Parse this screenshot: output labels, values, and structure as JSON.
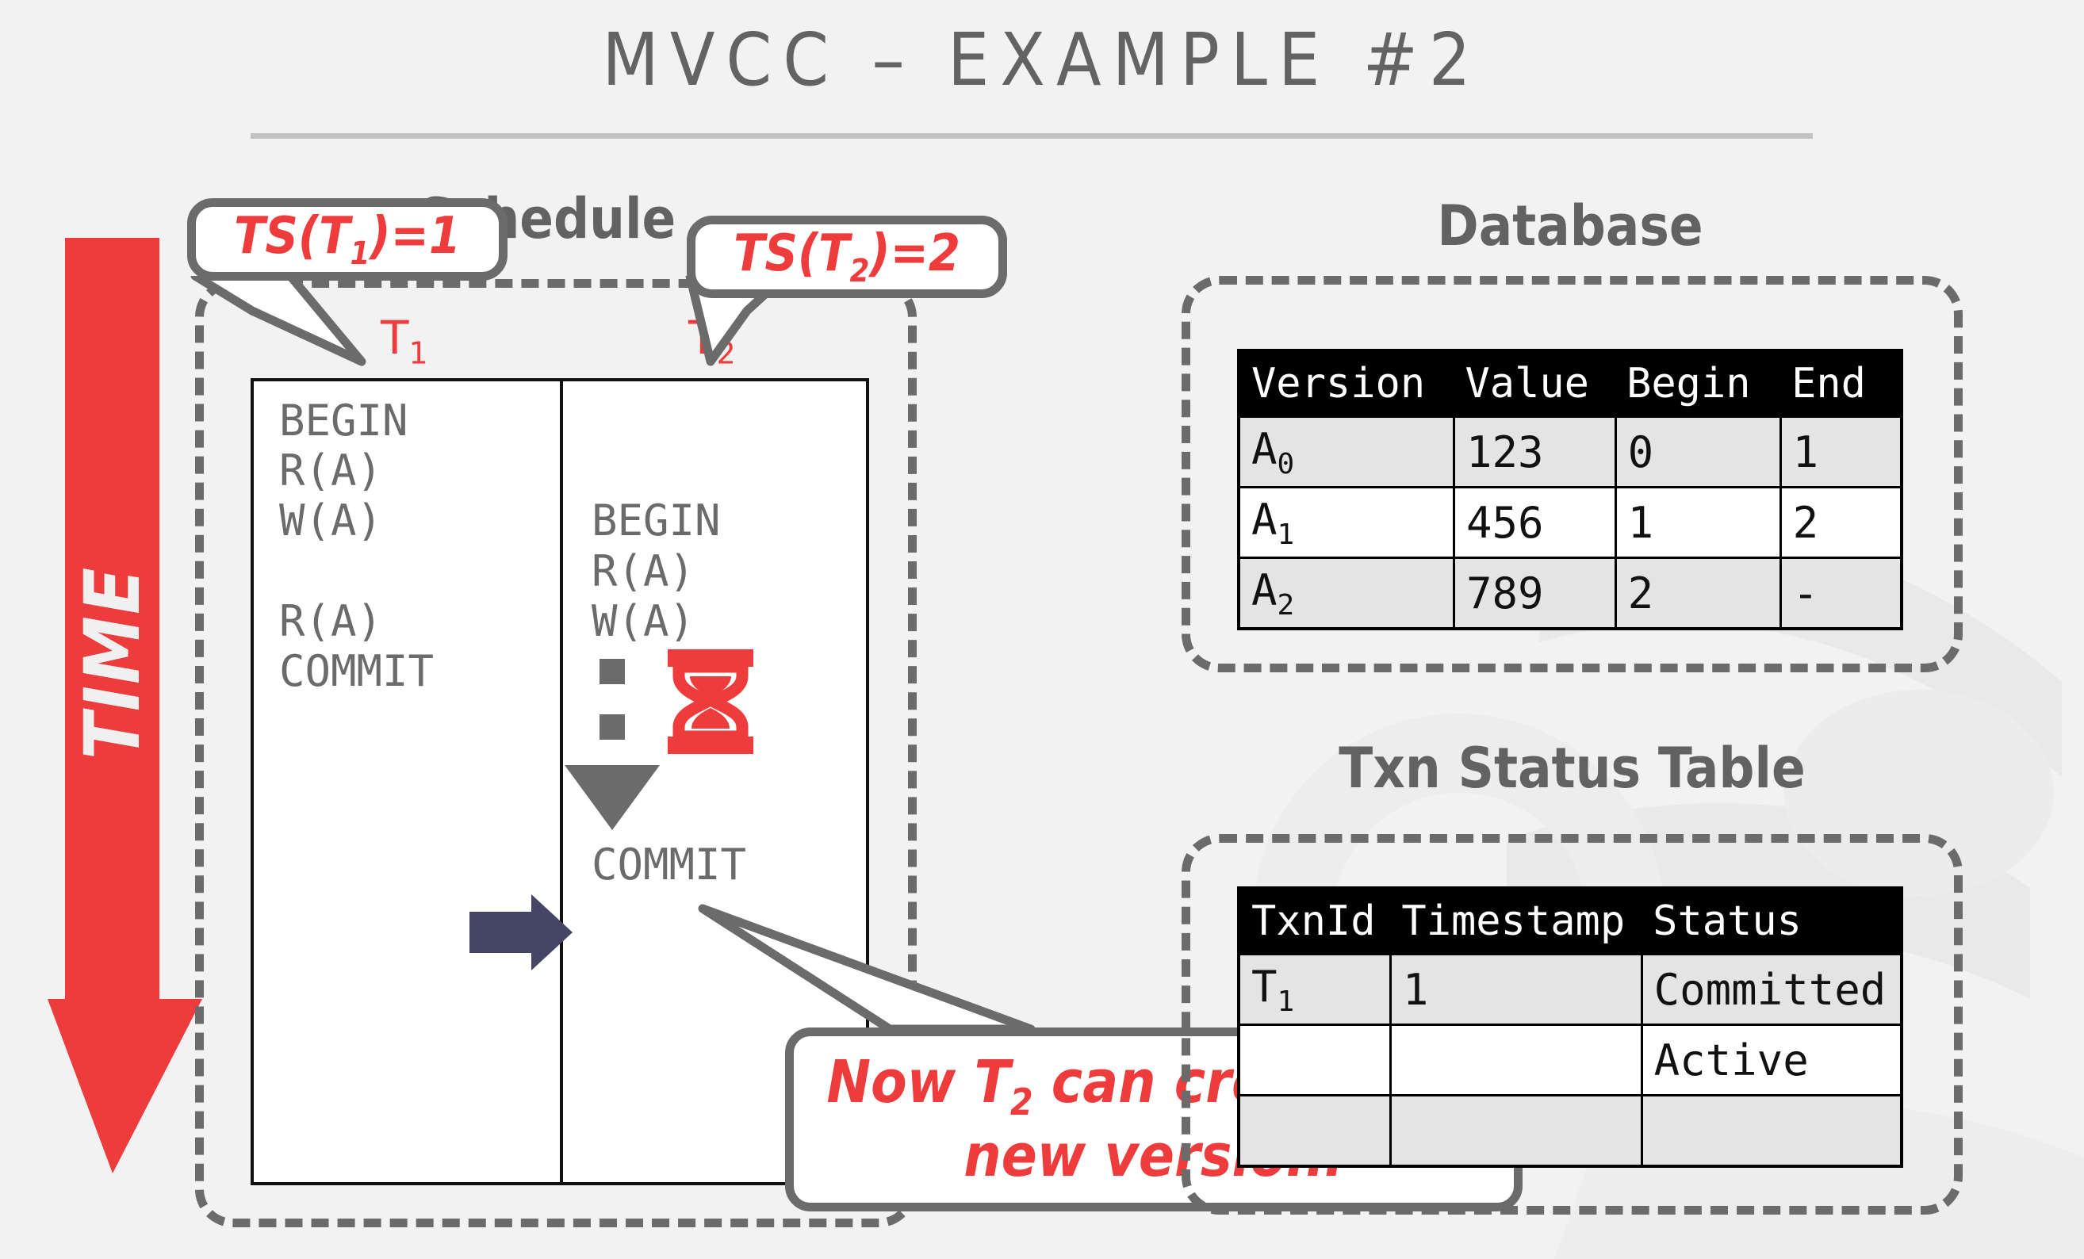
{
  "slide": {
    "title": "MVCC – EXAMPLE #2"
  },
  "time_axis": {
    "label": "TIME",
    "color": "#ee3b3b",
    "icon": "down-arrow-icon"
  },
  "schedule": {
    "heading": "Schedule",
    "columns": [
      {
        "header": "T",
        "header_sub": "1"
      },
      {
        "header": "T",
        "header_sub": "2"
      }
    ],
    "t1_ops": [
      "BEGIN",
      "R(A)",
      "W(A)",
      "",
      "R(A)",
      "COMMIT"
    ],
    "t2_ops": [
      "BEGIN",
      "R(A)",
      "W(A)"
    ],
    "t2_wait_icon": "hourglass-icon",
    "t2_wait_arrow_icon": "dashed-down-arrow-icon",
    "t2_commit": "COMMIT",
    "pointer_icon": "right-arrow-icon",
    "pointer_color": "#454664"
  },
  "callouts": {
    "ts_t1": {
      "prefix": "TS(T",
      "sub": "1",
      "suffix": ")=1"
    },
    "ts_t2": {
      "prefix": "TS(T",
      "sub": "2",
      "suffix": ")=2"
    },
    "note": {
      "line1_pre": "Now T",
      "line1_sub": "2",
      "line1_post": " can create the",
      "line2": "new version."
    }
  },
  "database": {
    "heading": "Database",
    "columns": [
      "Version",
      "Value",
      "Begin",
      "End"
    ],
    "rows": [
      {
        "shade": true,
        "cells": [
          {
            "text": "A",
            "sub": "0",
            "red": false
          },
          {
            "text": "123",
            "red": false
          },
          {
            "text": "0",
            "red": false
          },
          {
            "text": "1",
            "red": true
          }
        ]
      },
      {
        "shade": false,
        "cells": [
          {
            "text": "A",
            "sub": "1",
            "red": true
          },
          {
            "text": "456",
            "red": true
          },
          {
            "text": "1",
            "red": true
          },
          {
            "text": "2",
            "red": true
          }
        ]
      },
      {
        "shade": true,
        "cells": [
          {
            "text": "A",
            "sub": "2",
            "red": true
          },
          {
            "text": "789",
            "red": true
          },
          {
            "text": "2",
            "red": true
          },
          {
            "text": "-",
            "red": true
          }
        ]
      }
    ]
  },
  "txn_status": {
    "heading": "Txn Status Table",
    "columns": [
      "TxnId",
      "Timestamp",
      "Status"
    ],
    "rows": [
      {
        "shade": true,
        "cells": [
          {
            "text": "T",
            "sub": "1",
            "red": true
          },
          {
            "text": "1",
            "red": true
          },
          {
            "text": "Committed",
            "red": true
          }
        ]
      },
      {
        "shade": false,
        "cells": [
          {
            "text": "",
            "red": true
          },
          {
            "text": "",
            "red": true
          },
          {
            "text": "Active",
            "red": true
          }
        ]
      },
      {
        "shade": true,
        "cells": [
          {
            "text": "",
            "red": true
          },
          {
            "text": "",
            "red": true
          },
          {
            "text": "",
            "red": true
          }
        ]
      }
    ]
  },
  "colors": {
    "accent_red": "#ee3b3b",
    "heading_gray": "#626262",
    "dash_gray": "#6b6b6b",
    "navy": "#454664",
    "shade": "#e4e4e4"
  }
}
